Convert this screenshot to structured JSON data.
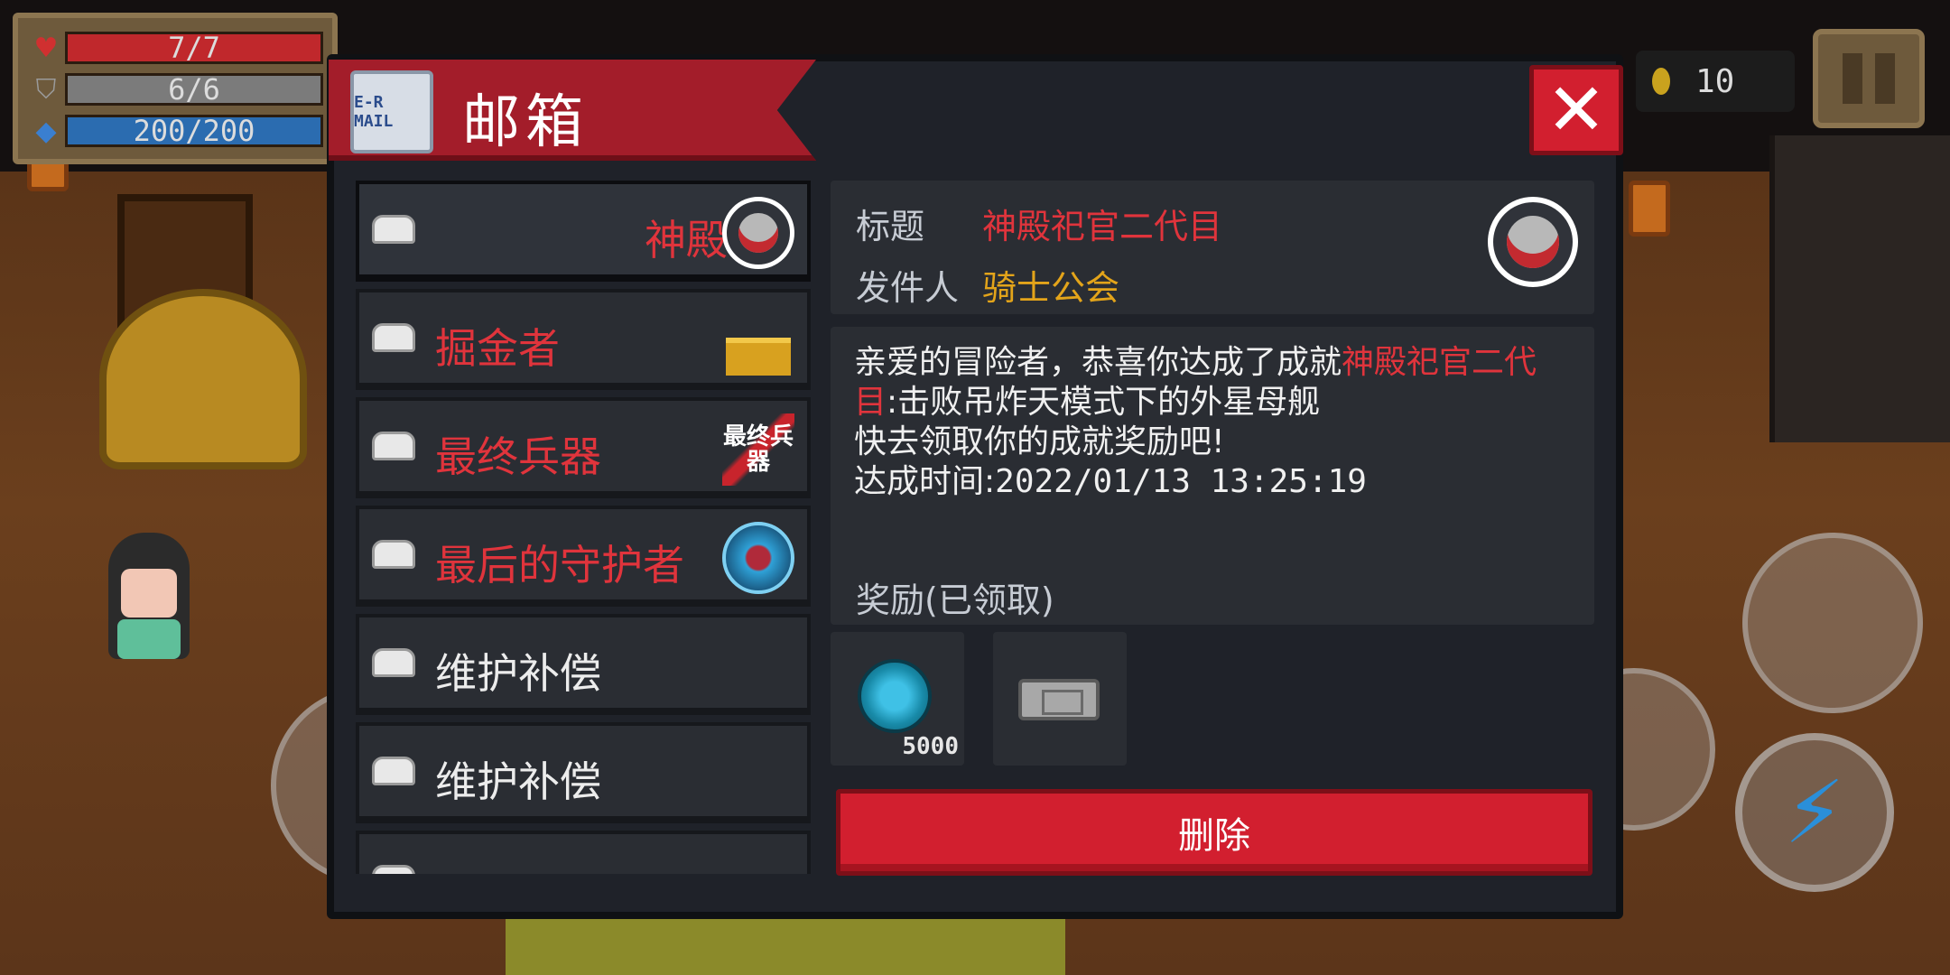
{
  "hud": {
    "hp": "7/7",
    "armor": "6/6",
    "energy": "200/200",
    "coins": "10",
    "icons": {
      "hp": "heart-icon",
      "armor": "shield-icon",
      "energy": "diamond-icon",
      "coin": "coin-icon",
      "pause": "pause-icon",
      "skill": "lightning-icon"
    }
  },
  "mailbox": {
    "title": "邮箱",
    "close_symbol": "✕",
    "mail_icon_text": "E-R MAIL",
    "items": [
      {
        "label": "神殿",
        "style": "red",
        "thumb": "portrait",
        "selected": true
      },
      {
        "label": "掘金者",
        "style": "red",
        "thumb": "shovel"
      },
      {
        "label": "最终兵器",
        "style": "red",
        "thumb": "weapon",
        "thumb_text": "最终兵器"
      },
      {
        "label": "最后的守护者",
        "style": "red",
        "thumb": "orb"
      },
      {
        "label": "维护补偿",
        "style": "white"
      },
      {
        "label": "维护补偿",
        "style": "white"
      },
      {
        "label": "",
        "style": "white"
      }
    ],
    "detail": {
      "title_key": "标题",
      "title_value": "神殿祀官二代目",
      "sender_key": "发件人",
      "sender_value": "骑士公会",
      "body_intro": "亲爱的冒险者，恭喜你达成了成就",
      "body_highlight": "神殿祀官二代目",
      "body_rest": ":击败吊炸天模式下的外星母舰",
      "body_line3": "快去领取你的成就奖励吧!",
      "body_time_label": "达成时间:",
      "body_time_value": "2022/01/13 13:25:19"
    },
    "rewards_label": "奖励(已领取)",
    "rewards": [
      {
        "icon": "gem-icon",
        "count": "5000"
      },
      {
        "icon": "ticket-icon",
        "count": ""
      }
    ],
    "delete_label": "删除"
  },
  "colors": {
    "accent_red": "#d21f2f",
    "highlight_red": "#e0343c",
    "sender_gold": "#e3a41a",
    "panel_bg": "#1f2229"
  }
}
